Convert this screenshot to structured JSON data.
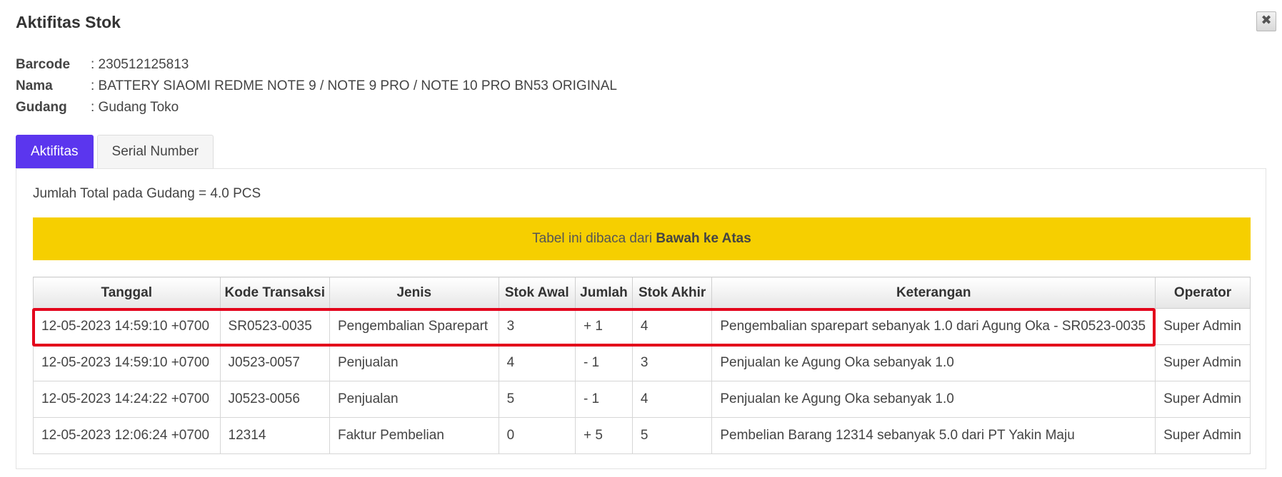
{
  "modal": {
    "title": "Aktifitas Stok",
    "close_label": "✖"
  },
  "info": [
    {
      "label": "Barcode",
      "value": ": 230512125813"
    },
    {
      "label": "Nama",
      "value": ": BATTERY SIAOMI REDME NOTE 9 / NOTE 9 PRO / NOTE 10 PRO BN53 ORIGINAL"
    },
    {
      "label": "Gudang",
      "value": ": Gudang Toko"
    }
  ],
  "tabs": [
    {
      "label": "Aktifitas",
      "active": true
    },
    {
      "label": "Serial Number",
      "active": false
    }
  ],
  "panel": {
    "total_text": "Jumlah Total pada Gudang = 4.0 PCS",
    "notice_prefix": "Tabel ini dibaca dari ",
    "notice_bold": "Bawah ke Atas"
  },
  "table": {
    "headers": [
      "Tanggal",
      "Kode Transaksi",
      "Jenis",
      "Stok Awal",
      "Jumlah",
      "Stok Akhir",
      "Keterangan",
      "Operator"
    ],
    "rows": [
      [
        "12-05-2023 14:59:10 +0700",
        "SR0523-0035",
        "Pengembalian Sparepart",
        "3",
        "+ 1",
        "4",
        "Pengembalian sparepart sebanyak 1.0 dari Agung Oka - SR0523-0035",
        "Super Admin"
      ],
      [
        "12-05-2023 14:59:10 +0700",
        "J0523-0057",
        "Penjualan",
        "4",
        "- 1",
        "3",
        "Penjualan ke Agung Oka sebanyak 1.0",
        "Super Admin"
      ],
      [
        "12-05-2023 14:24:22 +0700",
        "J0523-0056",
        "Penjualan",
        "5",
        "- 1",
        "4",
        "Penjualan ke Agung Oka sebanyak 1.0",
        "Super Admin"
      ],
      [
        "12-05-2023 12:06:24 +0700",
        "12314",
        "Faktur Pembelian",
        "0",
        "+ 5",
        "5",
        "Pembelian Barang 12314 sebanyak 5.0 dari PT Yakin Maju",
        "Super Admin"
      ]
    ]
  },
  "colors": {
    "tab_active": "#5b36ee",
    "notice_bg": "#f6cf00",
    "highlight": "#e3001b"
  }
}
